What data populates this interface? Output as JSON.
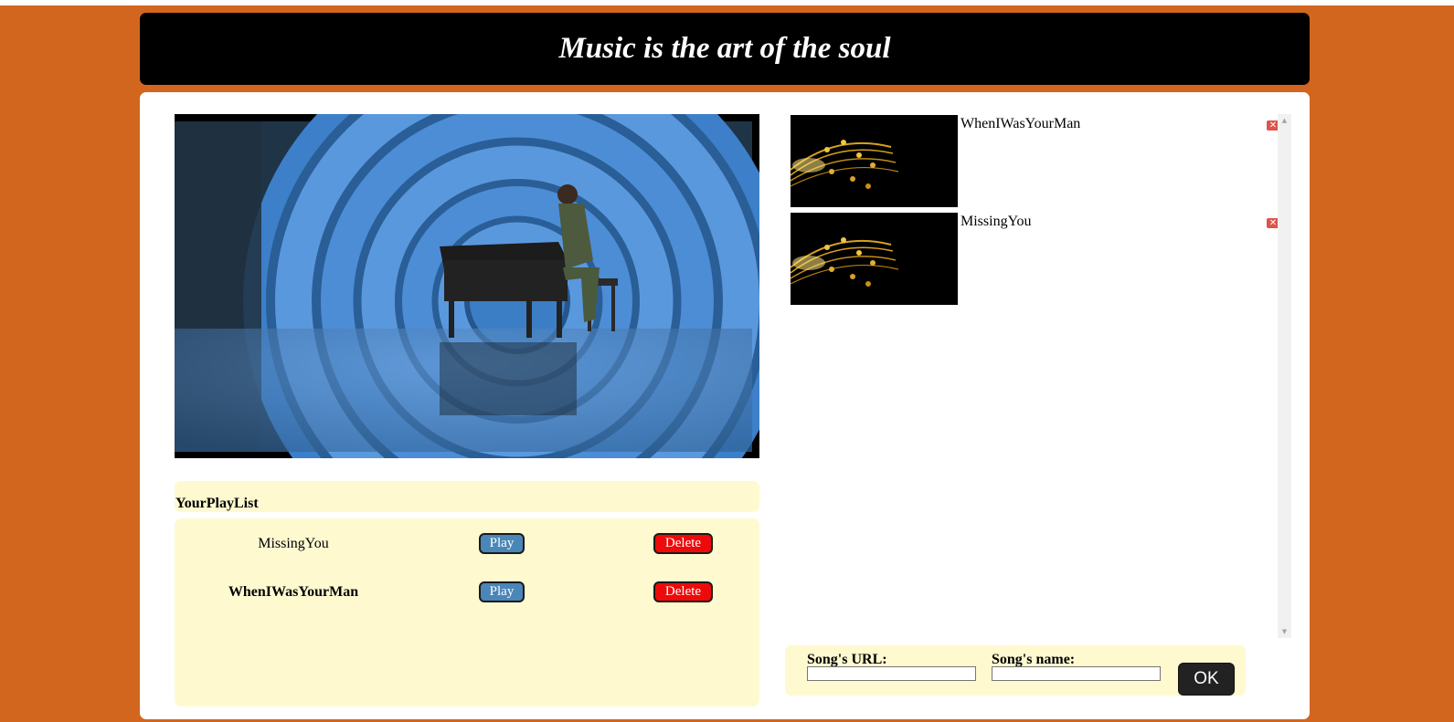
{
  "header": {
    "title": "Music is the art of the soul"
  },
  "player": {
    "video_label": "video-player"
  },
  "playlist": {
    "title": "YourPlayList",
    "items": [
      {
        "name": "MissingYou",
        "play_label": "Play",
        "delete_label": "Delete",
        "bold": false
      },
      {
        "name": "WhenIWasYourMan",
        "play_label": "Play",
        "delete_label": "Delete",
        "bold": true
      }
    ]
  },
  "library": {
    "items": [
      {
        "title": "WhenIWasYourMan",
        "remove_icon": "close-icon"
      },
      {
        "title": "MissingYou",
        "remove_icon": "close-icon"
      }
    ]
  },
  "add_form": {
    "url_label": "Song's URL:",
    "url_value": "",
    "name_label": "Song's name:",
    "name_value": "",
    "ok_label": "OK"
  },
  "colors": {
    "background": "#d2661f",
    "header_bg": "#000000",
    "panel_bg": "#fff9d0",
    "play_button": "#4a86b8",
    "delete_button": "#ee0a0a"
  }
}
